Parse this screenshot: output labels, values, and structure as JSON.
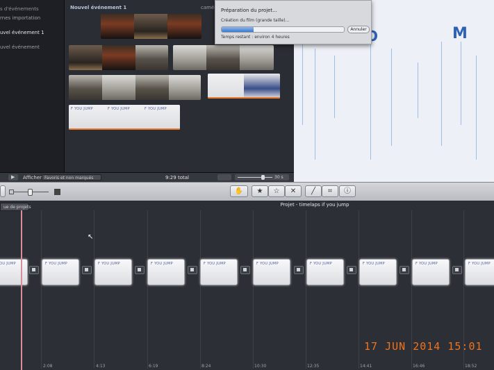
{
  "sidebar": {
    "header": "s d'événements",
    "items": [
      "rnes importation",
      "uvel événement 1",
      "uvel événement"
    ]
  },
  "browser": {
    "title": "Nouvel événement 1",
    "camera_label": "caméra"
  },
  "browser_bar": {
    "afficher_label": "Afficher",
    "filter_value": "Favoris et non marqués",
    "total": "9:29 total",
    "zoom_label": "30 s"
  },
  "progress": {
    "title": "Préparation du projet...",
    "subtitle": "Création du film (grande taille)...",
    "cancel_label": "Annuler",
    "remaining": "Temps restant : environ 4 heures",
    "fraction": 0.26
  },
  "toolbar": {
    "icons": [
      "hand-icon",
      "star-icon",
      "empty-star-icon",
      "reject-icon",
      "magic-wand-icon",
      "crop-icon",
      "info-icon"
    ]
  },
  "timeline": {
    "tab_label": "ue de projets",
    "title": "Projet - timelaps if you jump",
    "clip_text": "F YOU JUMP",
    "clip_text_right": "MP",
    "timestamps": [
      "2:08",
      "4:13",
      "6:19",
      "8:24",
      "10:30",
      "12:35",
      "14:41",
      "16:46",
      "18:52"
    ]
  },
  "stamp": {
    "date": "17 JUN 2014 15:01"
  },
  "colors": {
    "accent": "#3a78cf",
    "playhead": "#d98c9a",
    "stamp": "#f0731e"
  }
}
